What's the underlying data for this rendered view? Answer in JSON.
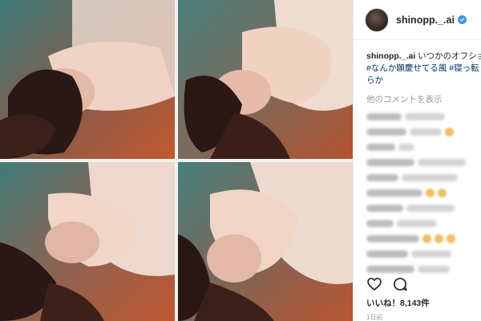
{
  "post": {
    "username": "shinopp._.ai",
    "caption_user": "shinopp._.ai",
    "caption_text": " いつかのオフショ",
    "hashtags": "#なんか願慶せてる風 #寝っ転",
    "caption_tail": "らか",
    "more_comments": "他のコメントを表示",
    "likes": "いいね！8,143件",
    "age": "1日前"
  },
  "icons": {
    "verified": "verified-badge-icon",
    "like": "heart-icon",
    "comment": "speech-bubble-icon"
  },
  "colors": {
    "link": "#003569",
    "verified": "#3897f0",
    "muted": "#999999",
    "text": "#262626"
  }
}
